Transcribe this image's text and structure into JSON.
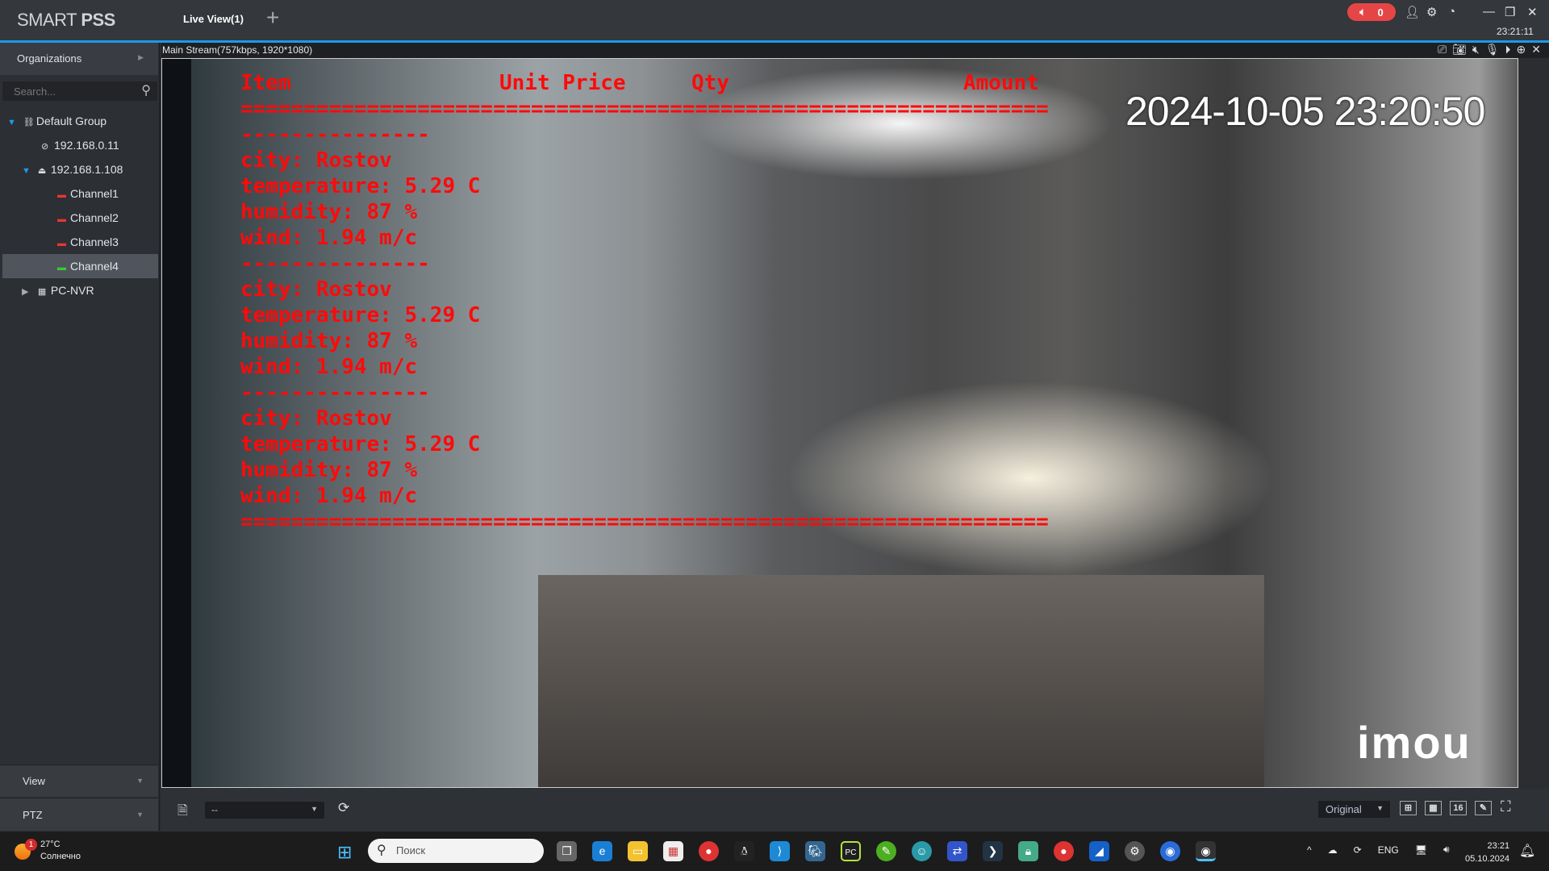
{
  "app": {
    "logo_light": "SMART ",
    "logo_bold": "PSS",
    "tab": "Live View(1)",
    "add_tab": "+",
    "alarm_count": "0",
    "clock": "23:21:11"
  },
  "sidebar": {
    "organizations": "Organizations",
    "search_placeholder": "Search...",
    "tree": [
      {
        "label": "Default Group"
      },
      {
        "label": "192.168.0.11"
      },
      {
        "label": "192.168.1.108"
      },
      {
        "label": "Channel1"
      },
      {
        "label": "Channel2"
      },
      {
        "label": "Channel3"
      },
      {
        "label": "Channel4",
        "selected": true
      },
      {
        "label": "PC-NVR"
      }
    ],
    "view": "View",
    "ptz": "PTZ"
  },
  "stream": {
    "header": "Main Stream(757kbps, 1920*1080)",
    "overlay": {
      "headers": [
        "Item",
        "Unit Price",
        "Qty",
        "Amount"
      ],
      "double_rule": "================================================================",
      "single_rule": "---------------",
      "blocks": [
        [
          "city: Rostov",
          "temperature: 5.29 C",
          "humidity: 87 %",
          "wind: 1.94 m/c"
        ],
        [
          "city: Rostov",
          "temperature: 5.29 C",
          "humidity: 87 %",
          "wind: 1.94 m/c"
        ],
        [
          "city: Rostov",
          "temperature: 5.29 C",
          "humidity: 87 %",
          "wind: 1.94 m/c"
        ]
      ]
    },
    "timestamp": "2024-10-05 23:20:50",
    "watermark": "imou"
  },
  "toolbar": {
    "preset": "--",
    "scale": "Original",
    "layout_16": "16"
  },
  "taskbar": {
    "weather_temp": "27°C",
    "weather_desc": "Солнечно",
    "weather_badge": "1",
    "search_placeholder": "Поиск",
    "lang": "ENG",
    "time": "23:21",
    "date": "05.10.2024"
  },
  "colors": {
    "accent": "#1a9be8",
    "overlay_text": "#ff0a0a",
    "alarm": "#e64545"
  }
}
